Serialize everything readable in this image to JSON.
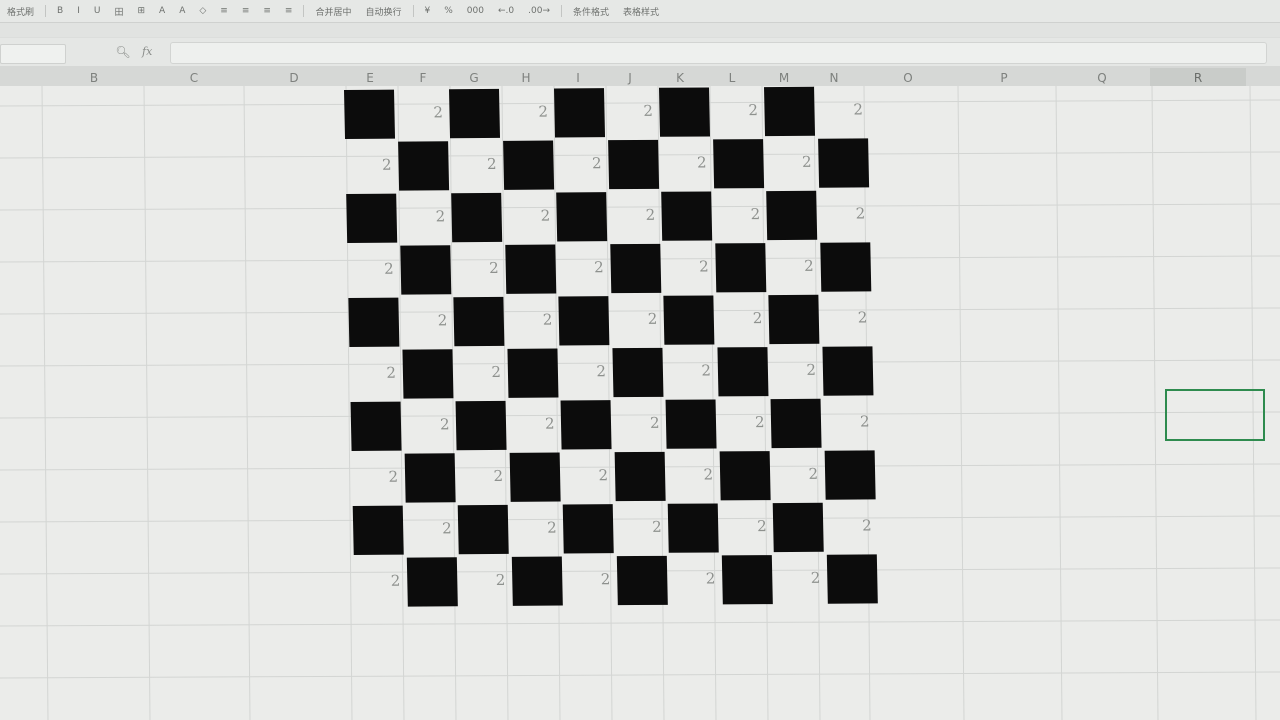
{
  "toolbar": {
    "items": [
      "格式刷",
      "B",
      "I",
      "U",
      "田",
      "⊞",
      "A",
      "A",
      "◇",
      "≡",
      "≡",
      "≡",
      "≡",
      "合并居中",
      "自动换行",
      "¥",
      "%",
      "000",
      "←.0",
      ".00→",
      "条件格式",
      "表格样式"
    ]
  },
  "formula_bar": {
    "name_box": "",
    "fx_label": "fx",
    "formula": ""
  },
  "columns": [
    "B",
    "C",
    "D",
    "E",
    "F",
    "G",
    "H",
    "I",
    "J",
    "K",
    "L",
    "M",
    "N",
    "O",
    "P",
    "Q",
    "R"
  ],
  "selected_column": "R",
  "board": {
    "rows": 10,
    "cols": 10,
    "cell_value": "2",
    "first_row_starts_with": "black"
  },
  "colors": {
    "black_cell": "#0c0c0c",
    "active_cell_border": "#2e8b4e"
  }
}
